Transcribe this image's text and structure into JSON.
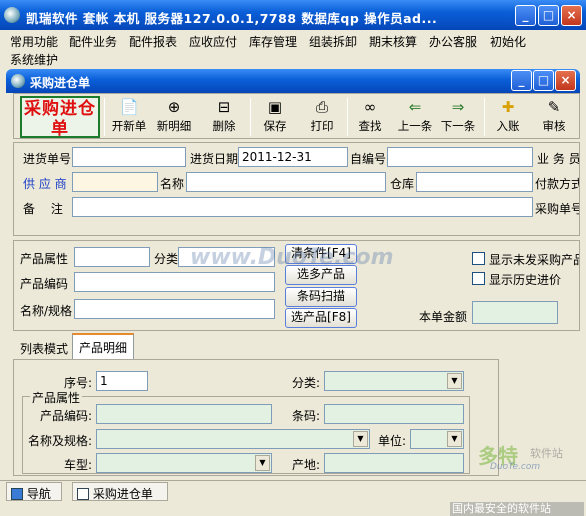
{
  "app": {
    "title": "凯瑞软件    套帐 本机    服务器127.0.0.1,7788    数据库qp    操作员ad..."
  },
  "window_controls": {
    "minimize": "_",
    "maximize": "□",
    "close": "×"
  },
  "menu": [
    "常用功能",
    "配件业务",
    "配件报表",
    "应收应付",
    "库存管理",
    "组装拆卸",
    "期末核算",
    "办公客服",
    "初始化",
    "系统维护"
  ],
  "child_window": {
    "title": "采购进仓单"
  },
  "toolbar": {
    "big_label": "采购进仓单",
    "buttons": [
      {
        "label": "开新单",
        "icon": "new-doc-icon"
      },
      {
        "label": "新明细",
        "icon": "new-detail-icon"
      },
      {
        "label": "删除",
        "icon": "delete-icon"
      },
      {
        "label": "保存",
        "icon": "save-icon"
      },
      {
        "label": "打印",
        "icon": "print-icon"
      },
      {
        "label": "查找",
        "icon": "binoculars-icon"
      },
      {
        "label": "上一条",
        "icon": "arrow-left-icon"
      },
      {
        "label": "下一条",
        "icon": "arrow-right-icon"
      },
      {
        "label": "入账",
        "icon": "post-icon"
      },
      {
        "label": "审核",
        "icon": "audit-icon"
      }
    ]
  },
  "header_form": {
    "order_no_label": "进货单号",
    "order_no": "",
    "date_label": "进货日期",
    "date": "2011-12-31",
    "self_no_label": "自编号",
    "self_no": "",
    "salesman_label": "业 务 员",
    "supplier_label": "供 应 商",
    "supplier": "",
    "name_label": "名称",
    "name": "",
    "warehouse_label": "仓库",
    "warehouse": "",
    "payment_label": "付款方式",
    "remark_label": "备　 注",
    "remark": "",
    "purchase_order_label": "采购单号"
  },
  "filter": {
    "attr_label": "产品属性",
    "category_label": "分类",
    "code_label": "产品编码",
    "name_spec_label": "名称/规格",
    "btn_clear": "清条件[F4]",
    "btn_multi": "选多产品",
    "btn_barcode": "条码扫描",
    "btn_select": "选产品[F8]",
    "chk_unshipped": "显示未发采购产品",
    "chk_history": "显示历史进价",
    "amount_label": "本单金额",
    "amount": ""
  },
  "tabs": [
    "列表模式",
    "产品明细"
  ],
  "detail": {
    "seq_label": "序号:",
    "seq": "1",
    "category_label": "分类:",
    "group_label": "产品属性",
    "code_label": "产品编码:",
    "barcode_label": "条码:",
    "name_spec_label": "名称及规格:",
    "unit_label": "单位:",
    "model_label": "车型:",
    "origin_label": "产地:"
  },
  "statusbar": {
    "nav": "导航",
    "doc": "采购进仓单"
  },
  "watermarks": {
    "site": "www.DuoTe.com",
    "brand": "多特",
    "brand_sub": "软件站",
    "brand_url": "DuoTe.com",
    "slogan": "国内最安全的软件站"
  },
  "colors": {
    "title_blue": "#0a5fd8",
    "label_red": "#e01010",
    "label_border": "#1c7c2c",
    "supplier_blue": "#1a3ec8"
  }
}
